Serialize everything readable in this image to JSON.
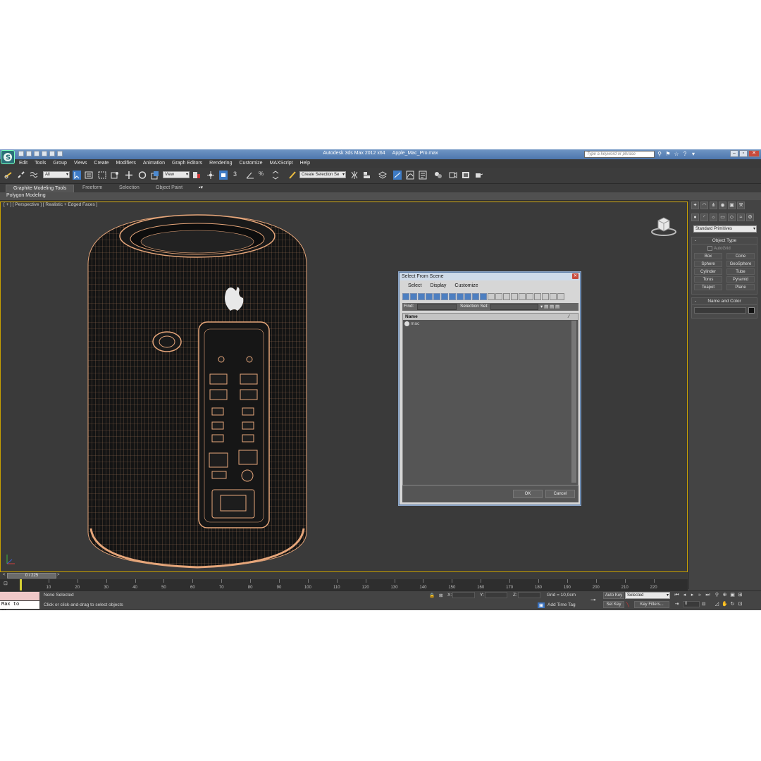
{
  "window": {
    "app_title": "Autodesk 3ds Max  2012 x64",
    "file_title": "Apple_Mac_Pro.max",
    "search_placeholder": "Type a keyword or phrase"
  },
  "menu": [
    "Edit",
    "Tools",
    "Group",
    "Views",
    "Create",
    "Modifiers",
    "Animation",
    "Graph Editors",
    "Rendering",
    "Customize",
    "MAXScript",
    "Help"
  ],
  "toolbar": {
    "selection_filter": "All",
    "ref_coord": "View",
    "snap_3": "3",
    "named_selection": "Create Selection Se"
  },
  "ribbon": {
    "tabs": [
      "Graphite Modeling Tools",
      "Freeform",
      "Selection",
      "Object Paint"
    ],
    "panel": "Polygon Modeling"
  },
  "viewport": {
    "label": "[ + ] [ Perspective ] [ Realistic + Edged Faces ]"
  },
  "command_panel": {
    "category": "Standard Primitives",
    "object_type_title": "Object Type",
    "autogrid": "AutoGrid",
    "buttons": [
      "Box",
      "Cone",
      "Sphere",
      "GeoSphere",
      "Cylinder",
      "Tube",
      "Torus",
      "Pyramid",
      "Teapot",
      "Plane"
    ],
    "name_color_title": "Name and Color"
  },
  "dialog": {
    "title": "Select From Scene",
    "menu": [
      "Select",
      "Display",
      "Customize"
    ],
    "find_label": "Find:",
    "selection_set_label": "Selection Set:",
    "column_name": "Name",
    "items": [
      "mac"
    ],
    "ok": "OK",
    "cancel": "Cancel"
  },
  "timeline": {
    "frame_indicator": "0 / 225",
    "ticks": [
      "10",
      "20",
      "30",
      "40",
      "50",
      "60",
      "70",
      "80",
      "90",
      "100",
      "110",
      "120",
      "130",
      "140",
      "150",
      "160",
      "170",
      "180",
      "190",
      "200",
      "210",
      "220"
    ]
  },
  "status": {
    "maxscript": "Max to Physc.",
    "selection": "None Selected",
    "prompt": "Click or click-and-drag to select objects",
    "x_label": "X:",
    "y_label": "Y:",
    "z_label": "Z:",
    "grid": "Grid = 10,0cm",
    "add_time_tag": "Add Time Tag",
    "auto_key": "Auto Key",
    "auto_key_mode": "Selected",
    "set_key": "Set Key",
    "key_filters": "Key Filters...",
    "frame": "0"
  },
  "colors": {
    "viewport_border": "#c8a000",
    "wire": "#e6a67a",
    "title_bar": "#5a82b6"
  }
}
